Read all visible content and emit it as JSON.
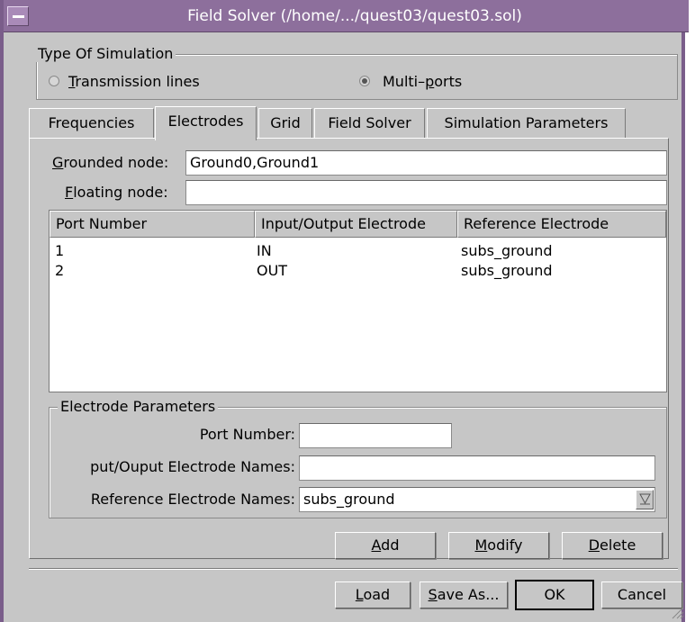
{
  "window": {
    "title": "Field Solver (/home/.../quest03/quest03.sol)"
  },
  "simulation_type": {
    "label": "Type Of Simulation",
    "options": [
      {
        "label_underline": "T",
        "label_rest": "ransmission lines",
        "selected": false
      },
      {
        "label_pre": "Multi–",
        "label_underline": "p",
        "label_rest": "orts",
        "selected": true
      }
    ]
  },
  "tabs": [
    {
      "label": "Frequencies",
      "active": false
    },
    {
      "label": "Electrodes",
      "active": true
    },
    {
      "label": "Grid",
      "active": false
    },
    {
      "label": "Field Solver",
      "active": false
    },
    {
      "label": "Simulation Parameters",
      "active": false
    }
  ],
  "electrodes": {
    "grounded_label_underline": "G",
    "grounded_label_rest": "rounded node:",
    "grounded_value": "Ground0,Ground1",
    "floating_label_underline": "F",
    "floating_label_rest": "loating node:",
    "floating_value": "",
    "table": {
      "columns": [
        "Port Number",
        "Input/Output Electrode",
        "Reference Electrode"
      ],
      "rows": [
        [
          "1",
          "IN",
          "subs_ground"
        ],
        [
          "2",
          "OUT",
          "subs_ground"
        ]
      ]
    },
    "params": {
      "label": "Electrode Parameters",
      "port_number_label": "Port Number:",
      "port_number_value": "",
      "io_names_label": "put/Ouput Electrode Names:",
      "io_names_value": "",
      "ref_names_label": "Reference Electrode Names:",
      "ref_names_value": "subs_ground"
    },
    "buttons": {
      "add_u": "A",
      "add_rest": "dd",
      "modify_u": "M",
      "modify_rest": "odify",
      "delete_u": "D",
      "delete_rest": "elete"
    }
  },
  "footer": {
    "load_u": "L",
    "load_rest": "oad",
    "saveas_u": "S",
    "saveas_rest": "ave As...",
    "ok": "OK",
    "cancel": "Cancel"
  }
}
